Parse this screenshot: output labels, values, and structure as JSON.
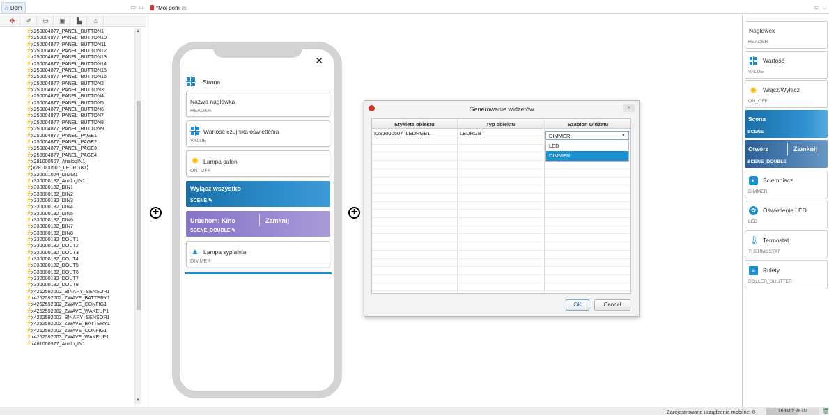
{
  "left_panel": {
    "tab_label": "Dom",
    "tree_items": [
      {
        "label": "x250004877_PANEL_BUTTON1"
      },
      {
        "label": "x250004877_PANEL_BUTTON10"
      },
      {
        "label": "x250004877_PANEL_BUTTON11"
      },
      {
        "label": "x250004877_PANEL_BUTTON12"
      },
      {
        "label": "x250004877_PANEL_BUTTON13"
      },
      {
        "label": "x250004877_PANEL_BUTTON14"
      },
      {
        "label": "x250004877_PANEL_BUTTON15"
      },
      {
        "label": "x250004877_PANEL_BUTTON16"
      },
      {
        "label": "x250004877_PANEL_BUTTON2"
      },
      {
        "label": "x250004877_PANEL_BUTTON3"
      },
      {
        "label": "x250004877_PANEL_BUTTON4"
      },
      {
        "label": "x250004877_PANEL_BUTTON5"
      },
      {
        "label": "x250004877_PANEL_BUTTON6"
      },
      {
        "label": "x250004877_PANEL_BUTTON7"
      },
      {
        "label": "x250004877_PANEL_BUTTON8"
      },
      {
        "label": "x250004877_PANEL_BUTTON9"
      },
      {
        "label": "x250004877_PANEL_PAGE1"
      },
      {
        "label": "x250004877_PANEL_PAGE2"
      },
      {
        "label": "x250004877_PANEL_PAGE3"
      },
      {
        "label": "x250004877_PANEL_PAGE4"
      },
      {
        "label": "x281000507_AnalogIN1"
      },
      {
        "label": "x281000507_LEDRGB1",
        "selected": true
      },
      {
        "label": "x320001024_DIMM1"
      },
      {
        "label": "x330000132_AnalogIN1"
      },
      {
        "label": "x330000132_DIN1"
      },
      {
        "label": "x330000132_DIN2"
      },
      {
        "label": "x330000132_DIN3"
      },
      {
        "label": "x330000132_DIN4"
      },
      {
        "label": "x330000132_DIN5"
      },
      {
        "label": "x330000132_DIN6"
      },
      {
        "label": "x330000132_DIN7"
      },
      {
        "label": "x330000132_DIN8"
      },
      {
        "label": "x330000132_DOUT1"
      },
      {
        "label": "x330000132_DOUT2"
      },
      {
        "label": "x330000132_DOUT3"
      },
      {
        "label": "x330000132_DOUT4"
      },
      {
        "label": "x330000132_DOUT5"
      },
      {
        "label": "x330000132_DOUT6"
      },
      {
        "label": "x330000132_DOUT7"
      },
      {
        "label": "x330000132_DOUT8"
      },
      {
        "label": "x4262592002_BINARY_SENSOR1"
      },
      {
        "label": "x4262592002_ZWAVE_BATTERY1"
      },
      {
        "label": "x4262592002_ZWAVE_CONFIG1"
      },
      {
        "label": "x4262592002_ZWAVE_WAKEUP1"
      },
      {
        "label": "x4262592003_BINARY_SENSOR1"
      },
      {
        "label": "x4262592003_ZWAVE_BATTERY1"
      },
      {
        "label": "x4262592003_ZWAVE_CONFIG1"
      },
      {
        "label": "x4262592003_ZWAVE_WAKEUP1"
      },
      {
        "label": "x461000377_AnalogIN1"
      }
    ]
  },
  "editor": {
    "tab_label": "*Mój dom",
    "tab_close": "☒",
    "phone": {
      "close_glyph": "✕",
      "page_item": {
        "title": "Strona"
      },
      "widgets": [
        {
          "title": "Nazwa nagłówka",
          "type": "HEADER"
        },
        {
          "title": "Wartość czujnika oświetlenia",
          "type": "VALUE"
        },
        {
          "title": "Lampa salon",
          "type": "ON_OFF"
        },
        {
          "title": "Wyłącz wszystko",
          "type": "SCENE"
        },
        {
          "title": "Uruchom: Kino",
          "title2": "Zamknij",
          "type": "SCENE_DOUBLE"
        },
        {
          "title": "Lampa sypialnia",
          "type": "DIMMER"
        }
      ]
    },
    "plus_glyph": "+"
  },
  "dialog": {
    "title": "Generowanie widżetów",
    "columns": [
      "Etykieta obiektu",
      "Typ obiektu",
      "Szablon widżetu"
    ],
    "rows": [
      {
        "label": "x281000507_LEDRGB1",
        "type": "LEDRGB",
        "template": "DIMMER"
      }
    ],
    "dropdown_options": [
      {
        "label": "LED",
        "selected": false
      },
      {
        "label": "DIMMER",
        "selected": true
      }
    ],
    "ok_label": "OK",
    "cancel_label": "Cancel"
  },
  "palette": {
    "items": [
      {
        "title": "Nagłówek",
        "type": "HEADER"
      },
      {
        "title": "Wartość",
        "type": "VALUE"
      },
      {
        "title": "Włącz/Wyłącz",
        "type": "ON_OFF"
      },
      {
        "title": "Scena",
        "type": "SCENE"
      },
      {
        "title": "Otwórz",
        "title2": "Zamknij",
        "type": "SCENE_DOUBLE"
      },
      {
        "title": "Ściemniacz",
        "type": "DIMMER"
      },
      {
        "title": "Oświetlenie LED",
        "type": "LED"
      },
      {
        "title": "Termostat",
        "type": "THERMOSTAT"
      },
      {
        "title": "Rolety",
        "type": "ROLLER_SHUTTER"
      }
    ]
  },
  "status_bar": {
    "devices_text": "Zarejestrowane urządzenia mobilne: 0",
    "memory_text": "169M z 287M",
    "memory_fraction": 0.59
  },
  "colors": {
    "accent": "#1a8fd3",
    "scene": "#2b8bc9",
    "scene_double": "#9b8ad3",
    "brand_red": "#d8312b"
  }
}
